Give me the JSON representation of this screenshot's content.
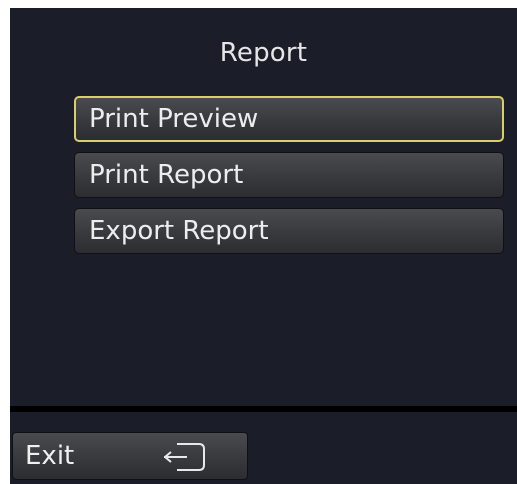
{
  "header": {
    "title": "Report"
  },
  "menu": {
    "items": [
      {
        "label": "Print Preview",
        "selected": true
      },
      {
        "label": "Print Report",
        "selected": false
      },
      {
        "label": "Export Report",
        "selected": false
      }
    ]
  },
  "footer": {
    "exit_label": "Exit",
    "exit_icon": "exit-door-icon"
  },
  "colors": {
    "panel_background": "#1b1d29",
    "button_background": "#3a3b3f",
    "selection_border": "#d7cf69",
    "text": "#ededed"
  }
}
